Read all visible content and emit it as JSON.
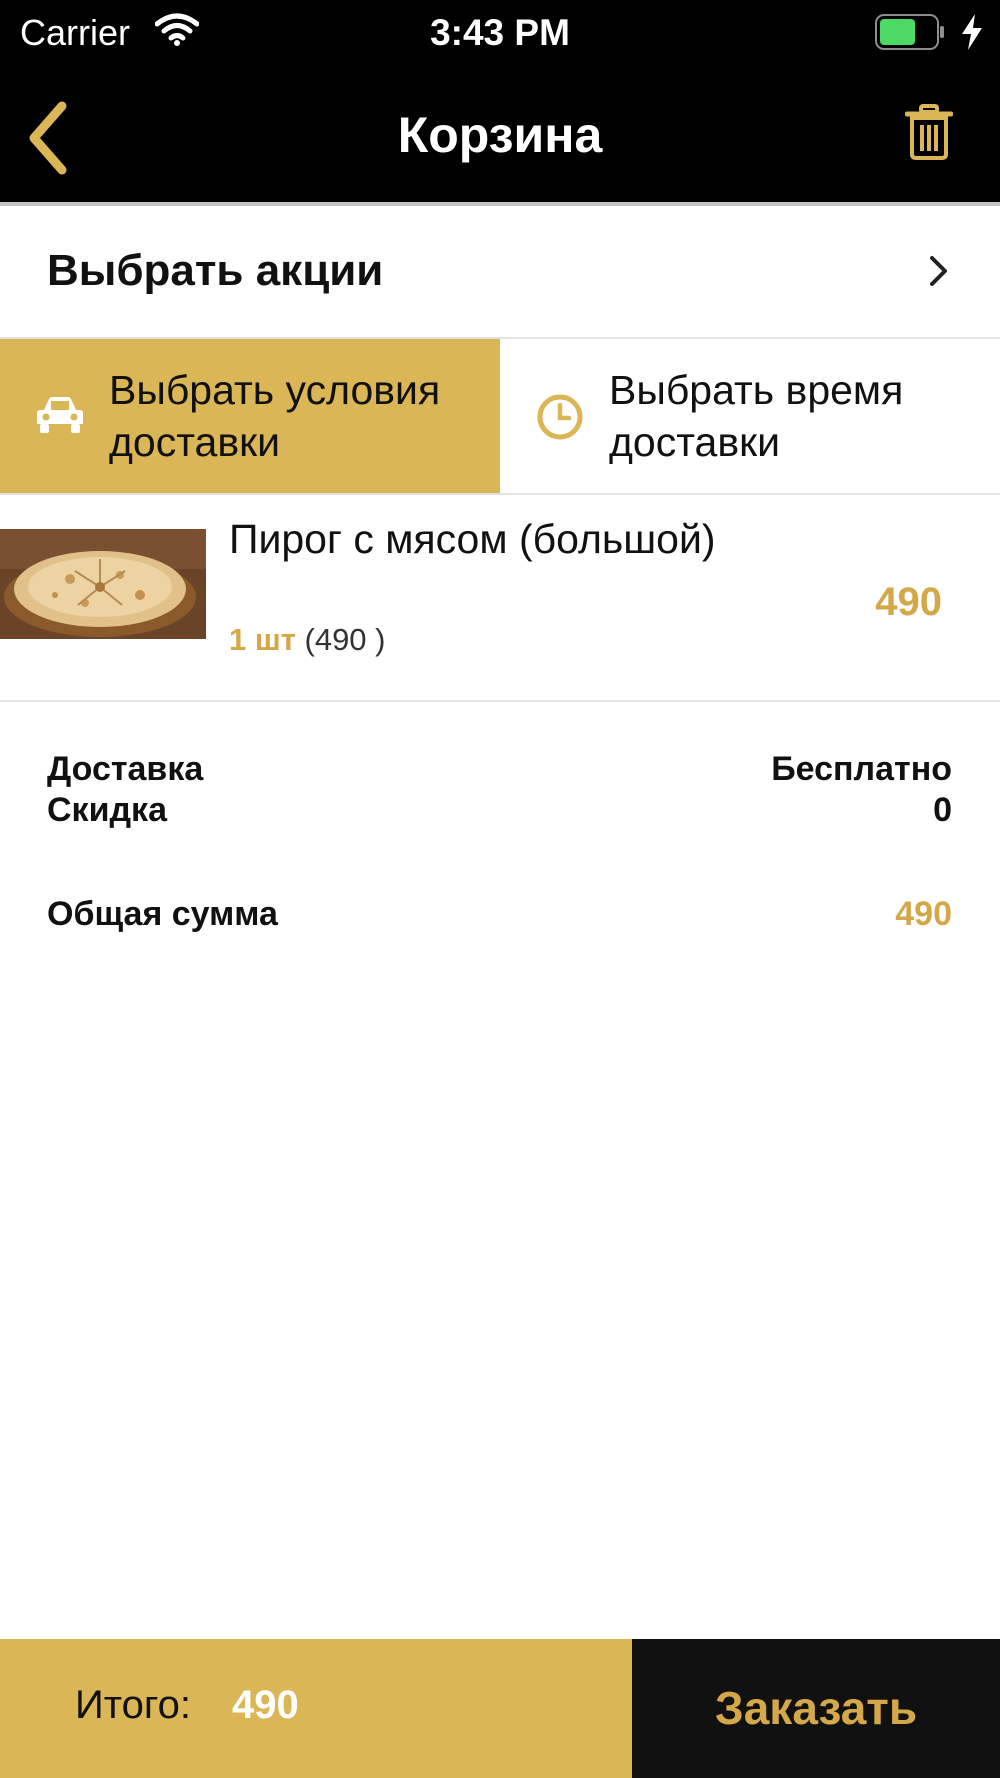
{
  "status_bar": {
    "carrier": "Carrier",
    "time": "3:43 PM"
  },
  "nav": {
    "title": "Корзина"
  },
  "promo": {
    "label": "Выбрать акции"
  },
  "options": {
    "delivery_conditions": [
      "Выбрать условия",
      "доставки"
    ],
    "delivery_time": [
      "Выбрать время",
      "доставки"
    ]
  },
  "cart_item": {
    "name": "Пирог с мясом (большой)",
    "qty": "1 шт",
    "unit_price": "(490 )",
    "price": "490"
  },
  "summary": {
    "delivery_label": "Доставка",
    "delivery_value": "Бесплатно",
    "discount_label": "Скидка",
    "discount_value": "0",
    "total_label": "Общая сумма",
    "total_value": "490"
  },
  "footer": {
    "itogo_label": "Итого:",
    "itogo_value": "490",
    "order_button": "Заказать"
  },
  "colors": {
    "accent": "#dbb657",
    "accent_text": "#d4a848",
    "bar": "#000000"
  }
}
